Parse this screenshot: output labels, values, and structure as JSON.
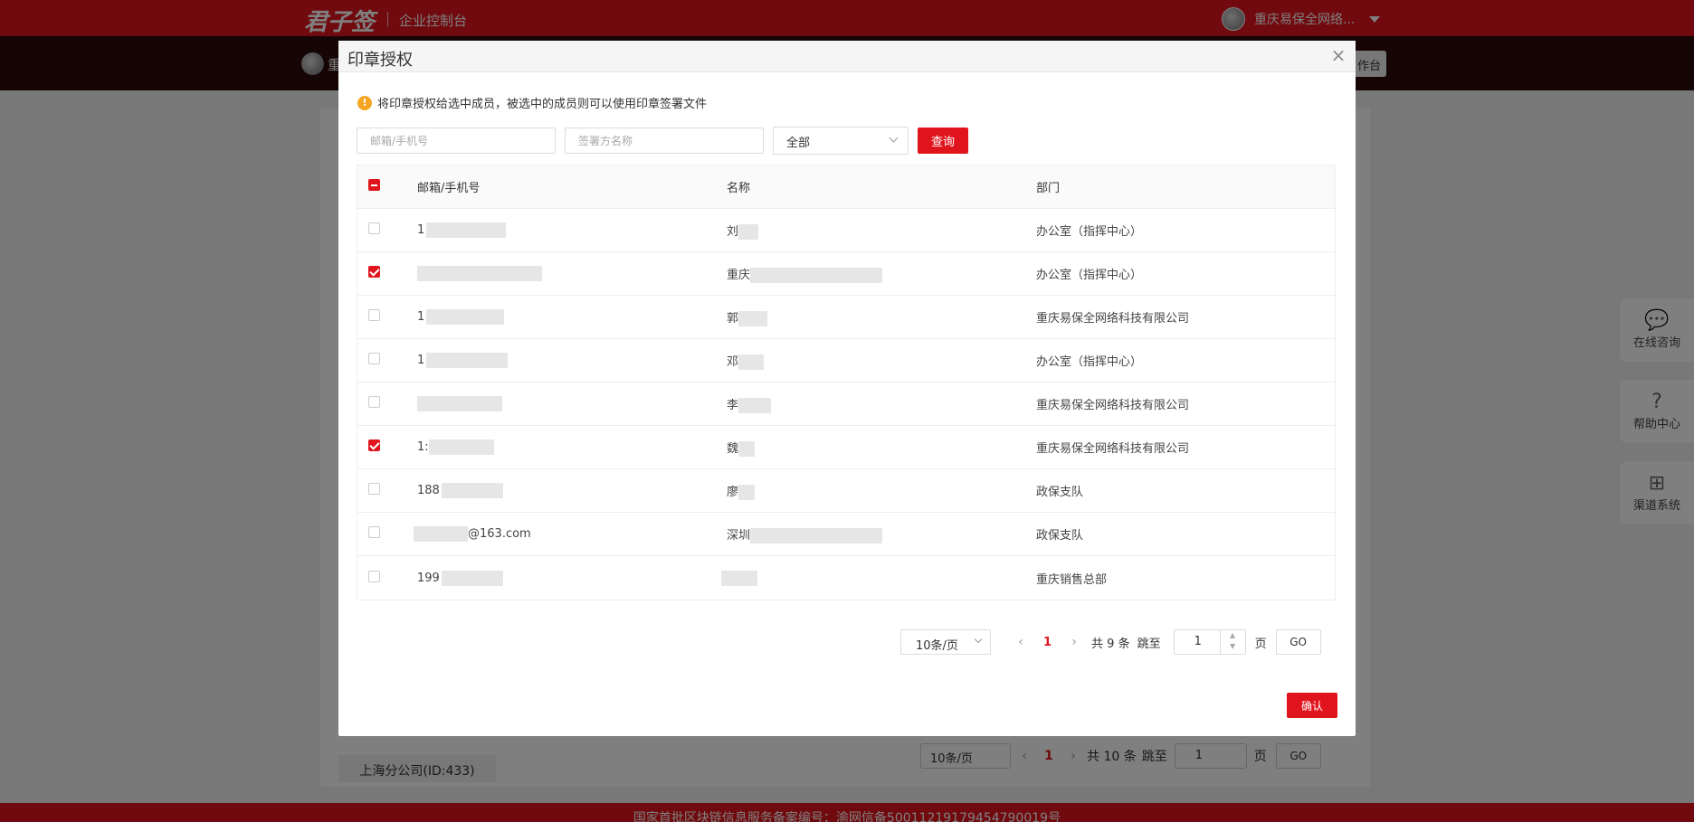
{
  "app": {
    "logo_text": "君子签",
    "console_title": "企业控制台",
    "user_name": "重庆易保全网络...",
    "subbar_char": "重",
    "workbench_label": "作台",
    "company_card": "上海分公司(ID:433)",
    "footer_text": "国家首批区块链信息服务备案编号：渝网信备50011219179454790019号",
    "bg_pager": {
      "per_page": "10条/页",
      "current_page": "1",
      "total_text": "共 10 条",
      "jump_label": "跳至",
      "jump_value": "1",
      "page_unit": "页",
      "go_label": "GO"
    },
    "side_buttons": [
      "在线咨询",
      "帮助中心",
      "渠道系统"
    ]
  },
  "modal": {
    "title": "印章授权",
    "notice": "将印章授权给选中成员，被选中的成员则可以使用印章签署文件",
    "filters": {
      "phone_placeholder": "邮箱/手机号",
      "name_placeholder": "签署方名称",
      "dept_selected": "全部",
      "query_label": "查询"
    },
    "table": {
      "headers": {
        "phone": "邮箱/手机号",
        "name": "名称",
        "dept": "部门"
      },
      "rows": [
        {
          "phone": "1",
          "name": "刘",
          "dept": "办公室（指挥中心）",
          "checked": false
        },
        {
          "phone": "",
          "name": "重庆",
          "dept": "办公室（指挥中心）",
          "checked": true
        },
        {
          "phone": "1",
          "name": "郭",
          "dept": "重庆易保全网络科技有限公司",
          "checked": false
        },
        {
          "phone": "1",
          "name": "邓",
          "dept": "办公室（指挥中心）",
          "checked": false
        },
        {
          "phone": "",
          "name": "李",
          "dept": "重庆易保全网络科技有限公司",
          "checked": false
        },
        {
          "phone": "1:",
          "name": "魏",
          "dept": "重庆易保全网络科技有限公司",
          "checked": true
        },
        {
          "phone": "188",
          "name": "廖",
          "dept": "政保支队",
          "checked": false
        },
        {
          "phone": "@163.com",
          "name": "深圳",
          "dept": "政保支队",
          "checked": false
        },
        {
          "phone": "199",
          "name": "",
          "dept": "重庆销售总部",
          "checked": false
        }
      ]
    },
    "pager": {
      "per_page": "10条/页",
      "current_page": "1",
      "total_text": "共 9 条",
      "jump_label": "跳至",
      "jump_value": "1",
      "page_unit": "页",
      "go_label": "GO"
    },
    "confirm_label": "确认",
    "colors": {
      "accent": "#e0141c",
      "warning": "#f5a623"
    }
  }
}
